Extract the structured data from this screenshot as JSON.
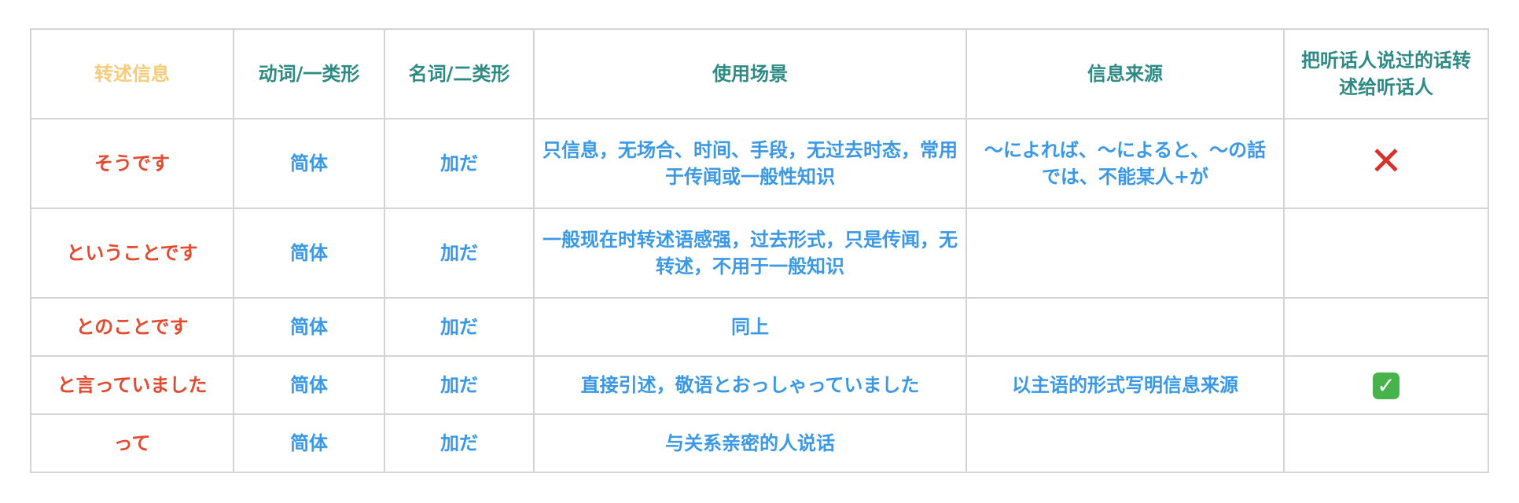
{
  "table": {
    "headers": [
      "转述信息",
      "动词/一类形",
      "名词/二类形",
      "使用场景",
      "信息来源",
      "把听话人说过的话转述给听话人"
    ],
    "rows": [
      {
        "form": "そうです",
        "verb_adj1": "简体",
        "noun_adj2": "加だ",
        "usage": "只信息，无场合、时间、手段，无过去时态，常用于传闻或一般性知识",
        "source": "～によれば、～によると、～の話では、不能某人+が",
        "relay_icon": "cross-mark-icon"
      },
      {
        "form": "ということです",
        "verb_adj1": "简体",
        "noun_adj2": "加だ",
        "usage": "一般现在时转述语感强，过去形式，只是传闻，无转述，不用于一般知识",
        "source": "",
        "relay_icon": ""
      },
      {
        "form": "とのことです",
        "verb_adj1": "简体",
        "noun_adj2": "加だ",
        "usage": "同上",
        "source": "",
        "relay_icon": ""
      },
      {
        "form": "と言っていました",
        "verb_adj1": "简体",
        "noun_adj2": "加だ",
        "usage": "直接引述，敬语とおっしゃっていました",
        "source": "以主语的形式写明信息来源",
        "relay_icon": "check-mark-button-icon"
      },
      {
        "form": "って",
        "verb_adj1": "简体",
        "noun_adj2": "加だ",
        "usage": "与关系亲密的人说话",
        "source": "",
        "relay_icon": ""
      }
    ]
  },
  "colors": {
    "first_header": "#f6cb79",
    "header": "#2e8b84",
    "form_text": "#e44a2f",
    "body_text": "#3a98e6",
    "border": "#d4d4d4",
    "cross_mark": "#d8312a",
    "check_mark_bg": "#46b34b"
  }
}
